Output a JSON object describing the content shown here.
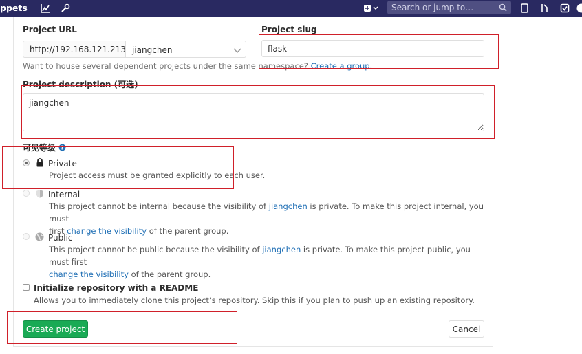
{
  "topbar": {
    "brand_fragment": "ppets",
    "search_placeholder": "Search or jump to…",
    "colors": {
      "background": "#292961"
    }
  },
  "form": {
    "project_url_label": "Project URL",
    "url_prefix": "http://192.168.121.213/",
    "namespace_value": "jiangchen",
    "project_slug_label": "Project slug",
    "project_slug_value": "flask",
    "namespace_help_text": "Want to house several dependent projects under the same namespace?",
    "namespace_help_link": "Create a group.",
    "description_label": "Project description (可选)",
    "description_value": "jiangchen",
    "visibility_label": "可见等级",
    "visibility": {
      "private": {
        "title": "Private",
        "description": "Project access must be granted explicitly to each user."
      },
      "internal": {
        "title": "Internal",
        "desc_part1": "This project cannot be internal because the visibility of",
        "desc_link1": "jiangchen",
        "desc_part2": "is private. To make this project internal, you must",
        "desc_part3": "first",
        "desc_link2": "change the visibility",
        "desc_part4": "of the parent group."
      },
      "public": {
        "title": "Public",
        "desc_part1": "This project cannot be public because the visibility of",
        "desc_link1": "jiangchen",
        "desc_part2": "is private. To make this project public, you must first",
        "desc_link2": "change the visibility",
        "desc_part3": "of the parent group."
      }
    },
    "readme_label": "Initialize repository with a README",
    "readme_help": "Allows you to immediately clone this project’s repository. Skip this if you plan to push up an existing repository.",
    "create_button": "Create project",
    "cancel_button": "Cancel"
  },
  "colors": {
    "primary_button": "#1aaa55",
    "link": "#1f6fb5",
    "annotation": "#d0202a"
  }
}
